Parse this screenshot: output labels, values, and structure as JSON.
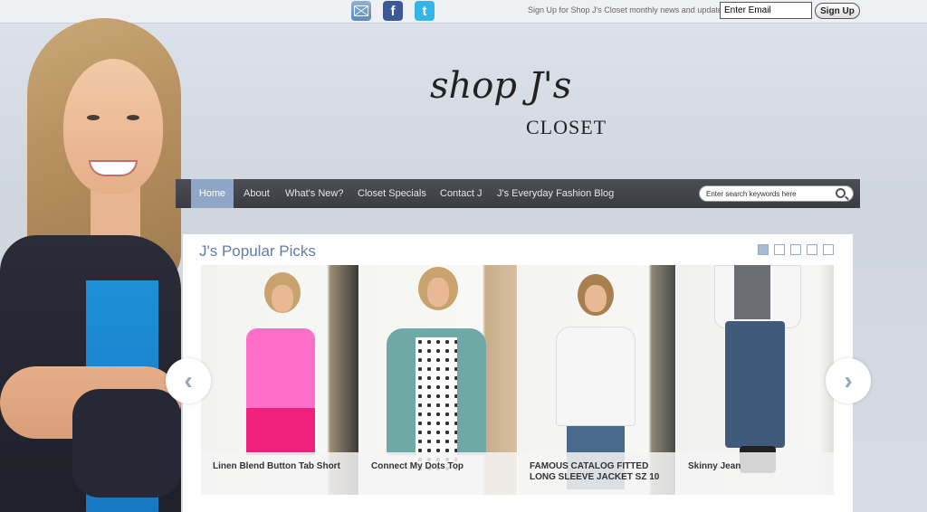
{
  "topbar": {
    "icons": [
      "mail-icon",
      "facebook-icon",
      "twitter-icon"
    ],
    "signup_text": "Sign Up for Shop J's Closet monthly news and updates.",
    "email_value": "Enter Email",
    "signup_button": "Sign Up"
  },
  "logo": {
    "script": "shop J's",
    "closet": "CLOSET"
  },
  "nav": {
    "items": [
      "Home",
      "About",
      "What's New?",
      "Closet Specials",
      "Contact J",
      "J's Everyday Fashion Blog"
    ],
    "active": "Home",
    "search_placeholder": "Enter search keywords here"
  },
  "picks": {
    "title": "J's Popular Picks",
    "products": [
      {
        "caption": "Linen Blend Button Tab Short"
      },
      {
        "caption": "Connect My Dots Top"
      },
      {
        "caption": "FAMOUS CATALOG FITTED LONG SLEEVE JACKET SZ 10"
      },
      {
        "caption": "Skinny Jean"
      }
    ],
    "slide_dots": 5,
    "active_dot": 1
  },
  "colors": {
    "accent": "#8fa6c6",
    "title": "#5c7fa9",
    "nav_bg": "#3f4147"
  }
}
